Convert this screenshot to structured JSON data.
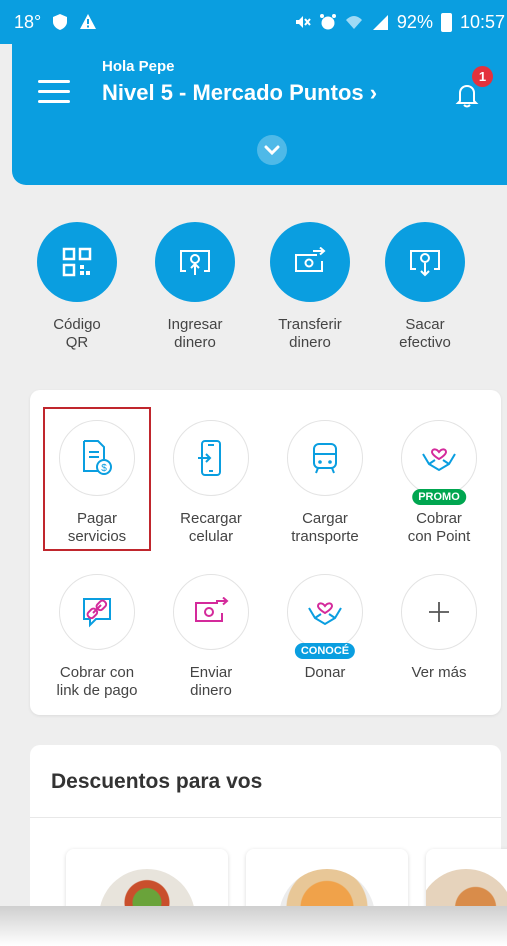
{
  "status_bar": {
    "temperature": "18°",
    "battery": "92%",
    "time": "10:57"
  },
  "header": {
    "greeting": "Hola Pepe",
    "level": "Nivel 5 - Mercado Puntos ›",
    "notification_count": "1"
  },
  "actions": [
    {
      "line1": "Código",
      "line2": "QR",
      "icon": "qr-code-icon"
    },
    {
      "line1": "Ingresar",
      "line2": "dinero",
      "icon": "deposit-money-icon"
    },
    {
      "line1": "Transferir",
      "line2": "dinero",
      "icon": "transfer-money-icon"
    },
    {
      "line1": "Sacar",
      "line2": "efectivo",
      "icon": "withdraw-cash-icon"
    }
  ],
  "services": [
    {
      "line1": "Pagar",
      "line2": "servicios",
      "icon": "bill-payment-icon"
    },
    {
      "line1": "Recargar",
      "line2": "celular",
      "icon": "phone-recharge-icon"
    },
    {
      "line1": "Cargar",
      "line2": "transporte",
      "icon": "bus-icon"
    },
    {
      "line1": "Cobrar",
      "line2": "con Point",
      "icon": "heart-hands-icon",
      "tag": "PROMO"
    },
    {
      "line1": "Cobrar con",
      "line2": "link de pago",
      "icon": "payment-link-icon"
    },
    {
      "line1": "Enviar",
      "line2": "dinero",
      "icon": "send-money-icon"
    },
    {
      "line1": "Donar",
      "line2": "",
      "icon": "donate-icon",
      "tag": "CONOCÉ"
    },
    {
      "line1": "Ver más",
      "line2": "",
      "icon": "plus-icon"
    }
  ],
  "discounts": {
    "title": "Descuentos para vos"
  },
  "colors": {
    "brand_blue": "#0a9ee0",
    "promo_green": "#00a650",
    "badge_red": "#e3323d",
    "highlight_red": "#c0262d",
    "accent_magenta": "#d42a9b"
  }
}
